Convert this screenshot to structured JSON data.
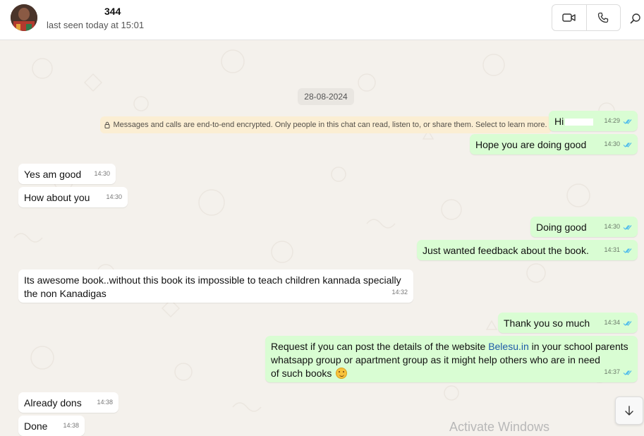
{
  "header": {
    "contact_name": "344",
    "last_seen": "last seen today at 15:01",
    "avatar_icon": "contact-avatar",
    "video_call_icon": "video-icon",
    "voice_call_icon": "phone-icon",
    "search_icon": "search-icon"
  },
  "chat": {
    "date": "28-08-2024",
    "encryption_notice": "Messages and calls are end-to-end encrypted. Only people in this chat can read, listen to, or share them. Select to learn more.",
    "messages": [
      {
        "direction": "out",
        "text": "Hi",
        "time": "14:29",
        "status": "read"
      },
      {
        "direction": "out",
        "text": "Hope you are doing good",
        "time": "14:30",
        "status": "read"
      },
      {
        "direction": "in",
        "text": "Yes am good",
        "time": "14:30"
      },
      {
        "direction": "in",
        "text": "How about you",
        "time": "14:30"
      },
      {
        "direction": "out",
        "text": "Doing good",
        "time": "14:30",
        "status": "read"
      },
      {
        "direction": "out",
        "text": "Just wanted feedback about the book.",
        "time": "14:31",
        "status": "read"
      },
      {
        "direction": "in",
        "line1": "Its awesome book..without this book its impossible to teach children kannada specially",
        "line2": "the non Kanadigas",
        "time": "14:32"
      },
      {
        "direction": "out",
        "text": "Thank you so much",
        "time": "14:34",
        "status": "read"
      },
      {
        "direction": "out",
        "line1_before": "Request if you can post the details of the website ",
        "link": "Belesu.in",
        "line1_after": " in your school parents",
        "line2": "whatsapp group or apartment group as it might help others who are in need",
        "line3": "of such books",
        "emoji": "smiling-face-emoji",
        "time": "14:37",
        "status": "read"
      },
      {
        "direction": "in",
        "text": "Already dons",
        "time": "14:38"
      },
      {
        "direction": "in",
        "text": "Done",
        "time": "14:38"
      }
    ],
    "read_tick_color": "#53bdeb",
    "outgoing_color": "#d9fdd3",
    "incoming_color": "#ffffff"
  },
  "overlay": {
    "watermark": "Activate Windows",
    "scroll_down_icon": "arrow-down-icon"
  }
}
